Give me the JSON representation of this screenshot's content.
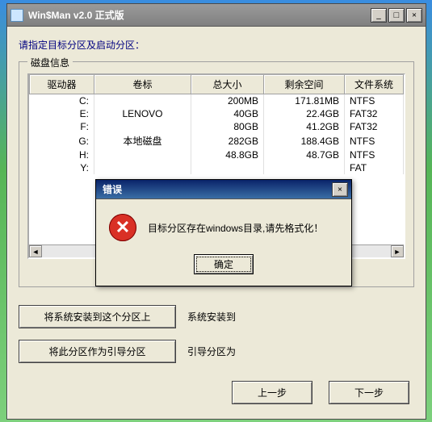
{
  "window": {
    "title": "Win$Man v2.0 正式版"
  },
  "instruction": "请指定目标分区及启动分区：",
  "group": {
    "legend": "磁盘信息"
  },
  "table": {
    "headers": [
      "驱动器",
      "卷标",
      "总大小",
      "剩余空间",
      "文件系统"
    ],
    "rows": [
      {
        "drive": "C:",
        "label": "",
        "size": "200MB",
        "free": "171.81MB",
        "fs": "NTFS"
      },
      {
        "drive": "E:",
        "label": "LENOVO",
        "size": "40GB",
        "free": "22.4GB",
        "fs": "FAT32"
      },
      {
        "drive": "F:",
        "label": "",
        "size": "80GB",
        "free": "41.2GB",
        "fs": "FAT32"
      },
      {
        "drive": "G:",
        "label": "本地磁盘",
        "size": "282GB",
        "free": "188.4GB",
        "fs": "NTFS"
      },
      {
        "drive": "H:",
        "label": "",
        "size": "48.8GB",
        "free": "48.7GB",
        "fs": "NTFS"
      },
      {
        "drive": "Y:",
        "label": "",
        "size": "",
        "free": "",
        "fs": "FAT"
      }
    ]
  },
  "buttons": {
    "install_to": "将系统安装到这个分区上",
    "install_label": "系统安装到",
    "boot_from": "将此分区作为引导分区",
    "boot_label": "引导分区为",
    "prev": "上一步",
    "next": "下一步"
  },
  "modal": {
    "title": "错误",
    "message": "目标分区存在windows目录,请先格式化！",
    "ok": "确定"
  }
}
